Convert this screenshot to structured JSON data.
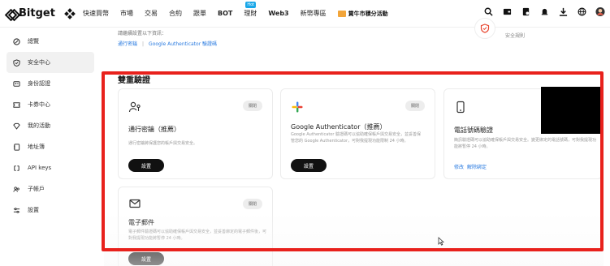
{
  "brand": {
    "name": "Bitget"
  },
  "nav": {
    "items": [
      "快速買幣",
      "市場",
      "交易",
      "合約",
      "跟單",
      "BOT",
      "理財",
      "Web3",
      "新幣專區"
    ],
    "hot_badge": "Hot",
    "promo": "賞牛市積分活動"
  },
  "sidebar": {
    "items": [
      {
        "label": "總覽",
        "icon": "overview-icon"
      },
      {
        "label": "安全中心",
        "icon": "shield-icon",
        "active": true
      },
      {
        "label": "身份認證",
        "icon": "id-card-icon"
      },
      {
        "label": "卡券中心",
        "icon": "coupon-icon"
      },
      {
        "label": "我的活動",
        "icon": "diamond-icon"
      },
      {
        "label": "地址簿",
        "icon": "book-icon"
      },
      {
        "label": "API keys",
        "icon": "key-icon"
      },
      {
        "label": "子帳戶",
        "icon": "sub-account-icon"
      },
      {
        "label": "設置",
        "icon": "settings-icon"
      }
    ]
  },
  "top": {
    "hint": "請繼續設置以下資訊：",
    "links": [
      "通行密鑰",
      "Google Authenticator 驗證碼"
    ],
    "status_label": "安全規則"
  },
  "section": {
    "title": "雙重驗證",
    "cards": [
      {
        "icon": "passkey-icon",
        "badge": "關閉",
        "title": "通行密鑰（推薦）",
        "desc": "通行密鑰將保護您的帳戶與交易安全。",
        "button": "設置"
      },
      {
        "icon": "google-authenticator-icon",
        "badge": "關閉",
        "title": "Google Authenticator（推薦）",
        "desc": "Google Authenticator 驗證碼可以協助確保帳戶與交易安全，並妥善保管您的 Google Authenticator，可對我提現功能限制 24 小時。",
        "button": "設置"
      },
      {
        "icon": "phone-icon",
        "title": "電話號碼驗證",
        "desc": "簡訊驗證碼可以協助確保帳戶與交易安全。變更綁定的電話號碼，可對我提現功能將暫停 24 小時。",
        "links": [
          "修改",
          "解除綁定"
        ]
      },
      {
        "icon": "mail-icon",
        "badge": "關閉",
        "title": "電子郵件",
        "desc": "電子郵件驗證碼可以協助確保帳戶與交易安全，並妥善綁定的電子郵件後，可對我提現功能將暫停 24 小時。",
        "button": "設置"
      }
    ]
  },
  "colors": {
    "accent_link": "#2a7be0",
    "highlight": "#e8211c",
    "button": "#111111"
  }
}
